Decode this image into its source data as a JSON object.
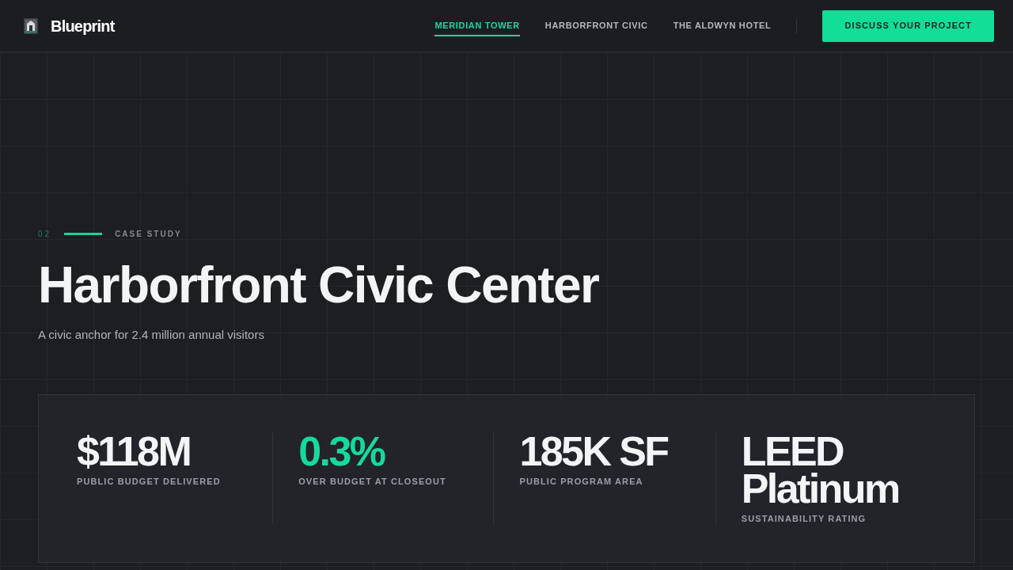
{
  "brand": {
    "name": "Blueprint"
  },
  "nav": {
    "links": [
      {
        "label": "MERIDIAN TOWER",
        "selected": true
      },
      {
        "label": "HARBORFRONT CIVIC",
        "selected": false
      },
      {
        "label": "THE ALDWYN HOTEL",
        "selected": false
      }
    ],
    "cta": "DISCUSS YOUR PROJECT"
  },
  "hero": {
    "index": "02",
    "eyebrow": "CASE STUDY",
    "title": "Harborfront Civic Center",
    "subtitle": "A civic anchor for 2.4 million annual visitors"
  },
  "stats": [
    {
      "value": "$118M",
      "label": "PUBLIC BUDGET DELIVERED",
      "accent": false
    },
    {
      "value": "0.3%",
      "label": "OVER BUDGET AT CLOSEOUT",
      "accent": true
    },
    {
      "value": "185K SF",
      "label": "PUBLIC PROGRAM AREA",
      "accent": false
    },
    {
      "value": "LEED Platinum",
      "label": "SUSTAINABILITY RATING",
      "accent": false
    }
  ]
}
